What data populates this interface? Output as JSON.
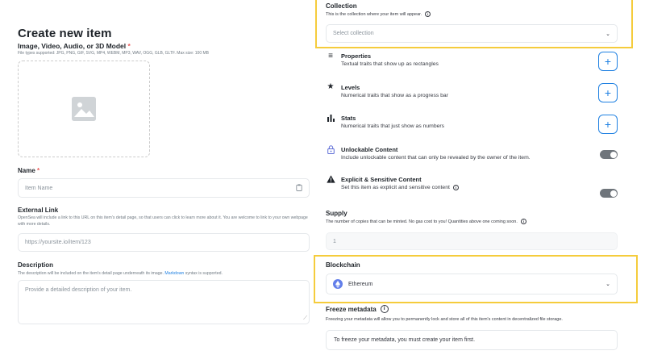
{
  "page": {
    "title": "Create new item",
    "media_label": "Image, Video, Audio, or 3D Model",
    "media_required": "*",
    "media_hint": "File types supported: JPG, PNG, GIF, SVG, MP4, WEBM, MP3, WAV, OGG, GLB, GLTF. Max size: 100 MB"
  },
  "name_field": {
    "label": "Name",
    "required": "*",
    "placeholder": "Item Name"
  },
  "external_link": {
    "label": "External Link",
    "description": "OpenSea will include a link to this URL on this item's detail page, so that users can click to learn more about it. You are welcome to link to your own webpage with more details.",
    "placeholder": "https://yoursite.io/item/123"
  },
  "description": {
    "label": "Description",
    "help_prefix": "The description will be included on the item's detail page underneath its image.",
    "help_link": "Markdown",
    "help_suffix": "syntax is supported.",
    "placeholder": "Provide a detailed description of your item."
  },
  "collection": {
    "label": "Collection",
    "description": "This is the collection where your item will appear.",
    "placeholder": "Select collection"
  },
  "traits": [
    {
      "icon": "≡",
      "icon_name": "list-icon",
      "title": "Properties",
      "subtitle": "Textual traits that show up as rectangles",
      "action": "+"
    },
    {
      "icon": "★",
      "icon_name": "star-icon",
      "title": "Levels",
      "subtitle": "Numerical traits that show as a progress bar",
      "action": "+"
    },
    {
      "icon": "▥",
      "icon_name": "bar-chart-icon",
      "title": "Stats",
      "subtitle": "Numerical traits that just show as numbers",
      "action": "+"
    }
  ],
  "unlockable": {
    "title": "Unlockable Content",
    "subtitle": "Include unlockable content that can only be revealed by the owner of the item."
  },
  "explicit": {
    "title": "Explicit & Sensitive Content",
    "subtitle": "Set this item as explicit and sensitive content"
  },
  "supply": {
    "label": "Supply",
    "description": "The number of copies that can be minted. No gas cost to you! Quantities above one coming soon.",
    "value": "1"
  },
  "blockchain": {
    "label": "Blockchain",
    "value": "Ethereum"
  },
  "freeze": {
    "label": "Freeze metadata",
    "description": "Freezing your metadata will allow you to permanently lock and store all of this item's content in decentralized file storage.",
    "notice": "To freeze your metadata, you must create your item first."
  },
  "colors": {
    "accent": "#2081e2",
    "highlight": "#f5cc3c",
    "required": "#eb5757",
    "ethereum": "#627eea"
  }
}
